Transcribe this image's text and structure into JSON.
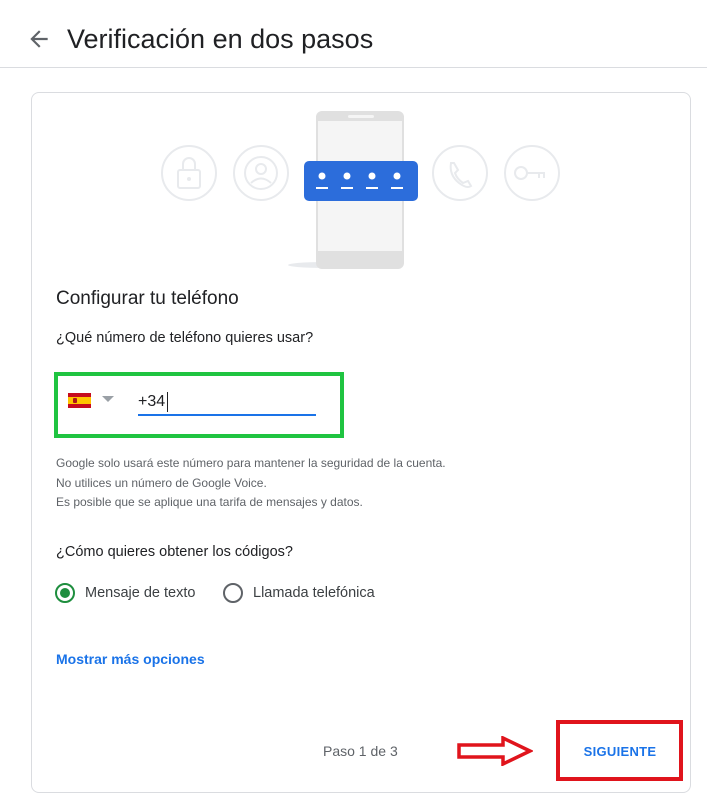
{
  "header": {
    "back_icon": "arrow-back-icon",
    "title": "Verificación en dos pasos"
  },
  "illustration": {
    "icons": [
      "lock-icon",
      "person-icon",
      "phone-icon",
      "key-icon"
    ],
    "code_dots": 4,
    "accent_color": "#2c6ddb"
  },
  "setup": {
    "title": "Configurar tu teléfono",
    "phone_question": "¿Qué número de teléfono quieres usar?",
    "country_flag": "es-flag-icon",
    "phone_value": "+34",
    "help_lines": [
      "Google solo usará este número para mantener la seguridad de la cuenta.",
      "No utilices un número de Google Voice.",
      "Es posible que se aplique una tarifa de mensajes y datos."
    ],
    "codes_question": "¿Cómo quieres obtener los códigos?",
    "options": [
      {
        "label": "Mensaje de texto",
        "selected": true
      },
      {
        "label": "Llamada telefónica",
        "selected": false
      }
    ],
    "more_options": "Mostrar más opciones"
  },
  "footer": {
    "step": "Paso 1 de 3",
    "next_label": "SIGUIENTE"
  },
  "colors": {
    "link": "#1a73e8",
    "radio_selected": "#1e8e3e",
    "highlight_green": "#1fc441",
    "highlight_red": "#e0141c"
  }
}
